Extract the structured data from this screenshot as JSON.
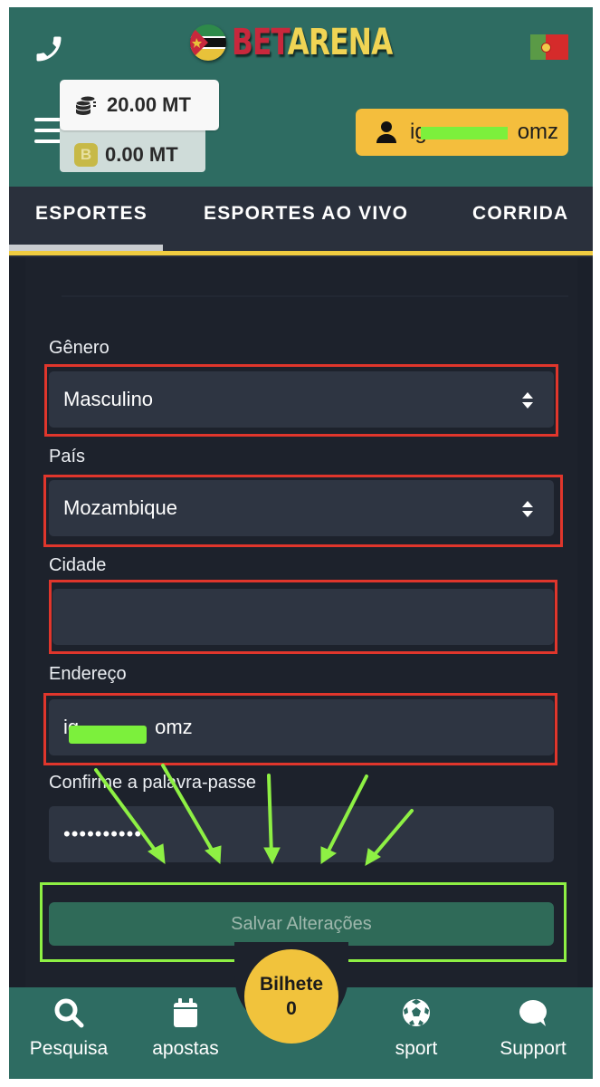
{
  "header": {
    "logo": {
      "part1": "BET",
      "part2": "ARENA"
    },
    "balance": "20.00 MT",
    "bonus_badge": "B",
    "bonus": "0.00 MT",
    "username_visible_end": "omz",
    "username_visible_start": "ig",
    "icons": {
      "phone": "phone-icon",
      "menu": "hamburger-icon",
      "language": "portugal-flag-icon",
      "user": "user-icon",
      "coins": "coins-icon"
    }
  },
  "tabs": [
    {
      "label": "ESPORTES",
      "active": true
    },
    {
      "label": "ESPORTES AO VIVO",
      "active": false
    },
    {
      "label": "CORRIDA",
      "active": false
    }
  ],
  "form": {
    "gender": {
      "label": "Gênero",
      "value": "Masculino"
    },
    "country": {
      "label": "País",
      "value": "Mozambique"
    },
    "city": {
      "label": "Cidade",
      "value": ""
    },
    "address": {
      "label": "Endereço",
      "value_start": "ig",
      "value_end": "omz"
    },
    "confirm_password": {
      "label": "Confirme a palavra-passe",
      "value": "••••••••••"
    },
    "save_label": "Salvar Alterações"
  },
  "colors": {
    "header_bg": "#2e6c62",
    "accent_yellow": "#f0cc40",
    "annotation_red": "#e0362c",
    "annotation_green": "#8ef044"
  },
  "bottom_nav": {
    "items": [
      {
        "label": "Pesquisa",
        "icon": "search-icon"
      },
      {
        "label": "apostas",
        "icon": "calendar-icon"
      },
      {
        "label": "sport",
        "icon": "soccer-ball-icon"
      },
      {
        "label": "Support",
        "icon": "chat-bubble-icon"
      }
    ],
    "ticket": {
      "label": "Bilhete",
      "count": "0"
    }
  }
}
